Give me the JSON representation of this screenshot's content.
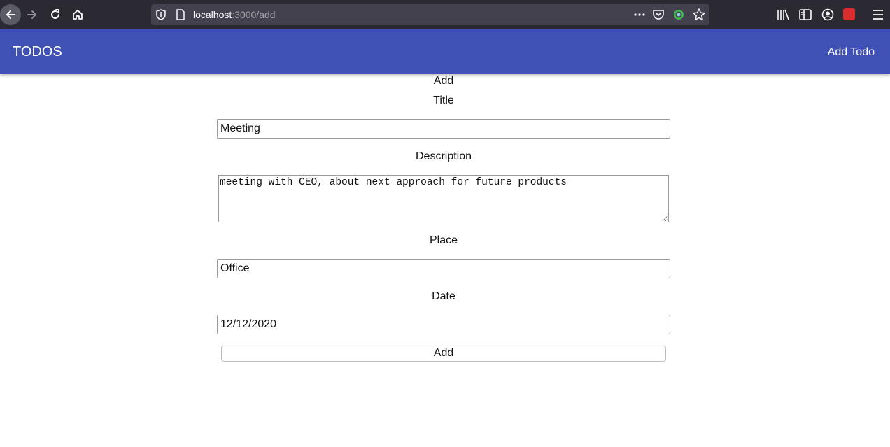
{
  "browser": {
    "url_host": "localhost",
    "url_path": ":3000/add",
    "icons": [
      "back-icon",
      "forward-icon",
      "reload-icon",
      "home-icon",
      "shield-icon",
      "page-icon",
      "more-icon",
      "pocket-icon",
      "extension-icon",
      "bookmark-star-icon",
      "library-icon",
      "sidebar-icon",
      "account-icon",
      "addon-icon",
      "menu-icon"
    ]
  },
  "appbar": {
    "title": "TODOS",
    "add_link": "Add Todo",
    "color": "#3f51b5"
  },
  "form": {
    "heading": "Add",
    "title_label": "Title",
    "title_value": "Meeting",
    "description_label": "Description",
    "description_value": "meeting with CEO, about next approach for future products",
    "place_label": "Place",
    "place_value": "Office",
    "date_label": "Date",
    "date_value": "12/12/2020",
    "submit_label": "Add"
  }
}
